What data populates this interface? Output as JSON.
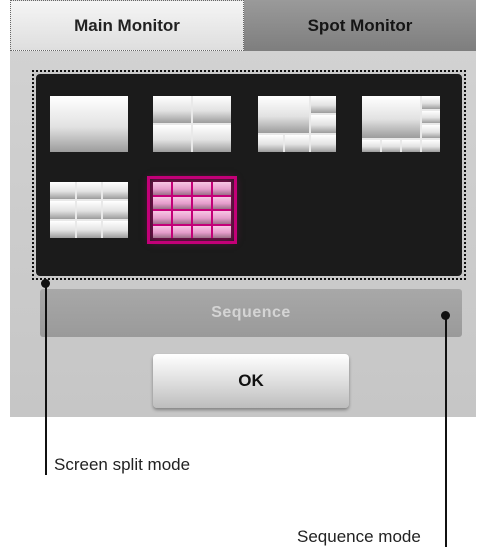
{
  "tabs": [
    {
      "label": "Main Monitor",
      "active": true
    },
    {
      "label": "Spot Monitor",
      "active": false
    }
  ],
  "split_layouts": [
    {
      "name": "1-screen",
      "grid": "1x1",
      "selected": false
    },
    {
      "name": "4-screen",
      "grid": "2x2",
      "selected": false
    },
    {
      "name": "6-screen",
      "grid": "3x3 with large cell",
      "selected": false
    },
    {
      "name": "8-screen",
      "grid": "4x4 with large cell",
      "selected": false
    },
    {
      "name": "9-screen",
      "grid": "3x3",
      "selected": false
    },
    {
      "name": "16-screen",
      "grid": "4x4",
      "selected": true
    }
  ],
  "buttons": {
    "sequence_label": "Sequence",
    "ok_label": "OK"
  },
  "callouts": {
    "screen_split": "Screen split mode",
    "sequence": "Sequence mode"
  },
  "colors": {
    "selection": "#c40078",
    "split_background": "#1b1b1b"
  }
}
